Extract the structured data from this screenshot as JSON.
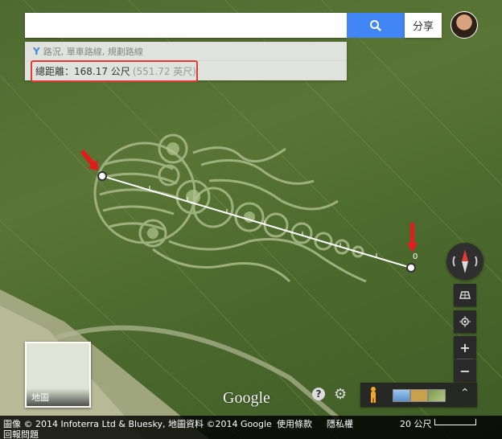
{
  "search": {
    "placeholder": "",
    "share_label": "分享"
  },
  "panel": {
    "route_hint": "路況, 單車路線, 規劃路線",
    "distance_label": "總距離：168.17 公尺",
    "distance_secondary": "(551.72 英尺)"
  },
  "thumbnail": {
    "label": "地圖"
  },
  "logo": {
    "text": "Google"
  },
  "controls": {
    "zoom_in": "+",
    "zoom_out": "−",
    "help": "?"
  },
  "footer": {
    "attribution": "圖像 © 2014 Infoterra Ltd & Bluesky, 地圖資料 ©2014 Google",
    "terms": "使用條款",
    "privacy": "隱私權",
    "report": "回報問題",
    "scale": "20 公尺"
  },
  "colors": {
    "search_blue": "#4285f4",
    "highlight_red": "#e53935",
    "field_green": "#567232"
  },
  "icons": {
    "search": "search-icon",
    "route": "route-icon",
    "compass": "compass-icon",
    "gear": "gear-icon",
    "pegman": "pegman-icon"
  }
}
